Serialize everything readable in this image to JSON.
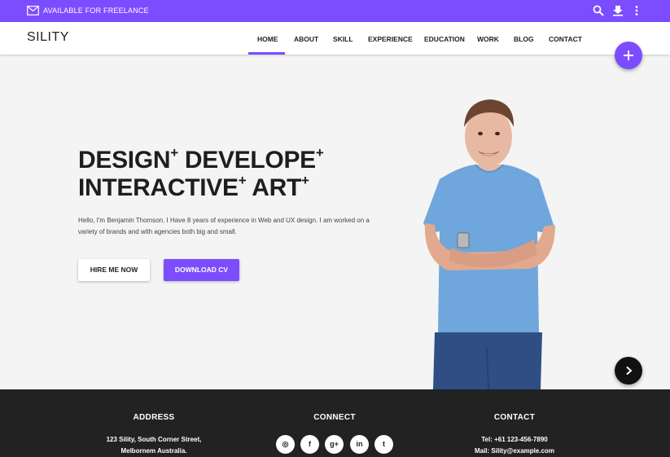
{
  "topbar": {
    "freelance_label": "AVAILABLE FOR FREELANCE",
    "icons": [
      "mail-icon",
      "search-icon",
      "download-icon",
      "more-vert-icon"
    ]
  },
  "nav": {
    "logo": "SILITY",
    "items": [
      {
        "label": "HOME",
        "active": true
      },
      {
        "label": "ABOUT"
      },
      {
        "label": "SKILL"
      },
      {
        "label": "EXPERIENCE"
      },
      {
        "label": "EDUCATION"
      },
      {
        "label": "WORK"
      },
      {
        "label": "BLOG"
      },
      {
        "label": "CONTACT"
      }
    ]
  },
  "hero": {
    "line1": [
      "DESIGN",
      "+",
      " DEVELOPE",
      "+"
    ],
    "line2": [
      "INTERACTIVE",
      "+",
      " ART",
      "+"
    ],
    "description": "Hello, I'm Benjamin Thomson. I Have 8 years of experience in Web and UX design. I am worked on a variety of brands and with agencies both big and small.",
    "hire_label": "HIRE ME NOW",
    "download_label": "DOWNLOAD CV"
  },
  "footer": {
    "address": {
      "title": "ADDRESS",
      "line1": "123 Sility, South Corner Street,",
      "line2": "Melbornem Australia."
    },
    "connect": {
      "title": "CONNECT",
      "socials": [
        "dribbble-icon",
        "facebook-icon",
        "google-plus-icon",
        "linkedin-icon",
        "twitter-icon"
      ],
      "glyphs": [
        "◎",
        "f",
        "g+",
        "in",
        "t"
      ]
    },
    "contact": {
      "title": "CONTACT",
      "tel": "Tel: +61 123-456-7890",
      "mail": "Mail: Sility@example.com"
    }
  },
  "colors": {
    "accent": "#7c4dff",
    "footer_bg": "#222222",
    "hero_bg": "#f4f4f4"
  }
}
